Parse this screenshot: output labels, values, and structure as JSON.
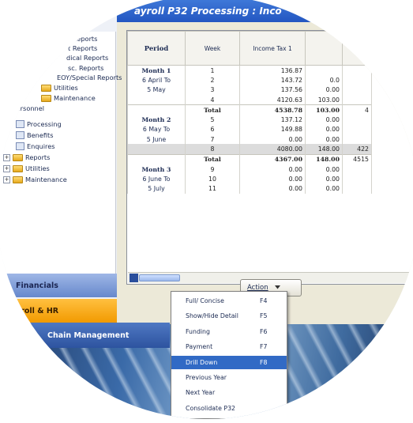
{
  "window": {
    "title": "ayroll P32 Processing : Inco"
  },
  "tree": {
    "items": [
      {
        "label": "Reports",
        "kind": "text"
      },
      {
        "label": "t Reports",
        "kind": "text"
      },
      {
        "label": "dical Reports",
        "kind": "text"
      },
      {
        "label": "sc. Reports",
        "kind": "text"
      },
      {
        "label": "EOY/Special Reports",
        "kind": "text"
      },
      {
        "label": "Utilities",
        "kind": "folder"
      },
      {
        "label": "Maintenance",
        "kind": "folder"
      },
      {
        "label": "Personnel",
        "kind": "folder"
      },
      {
        "label": "Processing",
        "kind": "doc"
      },
      {
        "label": "Benefits",
        "kind": "doc"
      },
      {
        "label": "Enquires",
        "kind": "doc"
      },
      {
        "label": "Reports",
        "kind": "folder"
      },
      {
        "label": "Utilities",
        "kind": "folder"
      },
      {
        "label": "Maintenance",
        "kind": "folder"
      }
    ]
  },
  "nav": {
    "financials": "Financials",
    "payroll": "yroll & HR",
    "chain": "Chain Management"
  },
  "grid": {
    "headers": [
      "Period",
      "Week",
      "Income Tax 1",
      "",
      ""
    ],
    "rows": [
      {
        "period": "Month 1",
        "pb": true,
        "week": "1",
        "tax": "136.87",
        "c4": "",
        "c5": ""
      },
      {
        "period": "6 April To",
        "week": "2",
        "tax": "143.72",
        "c4": "0.0",
        "c5": ""
      },
      {
        "period": "5 May",
        "week": "3",
        "tax": "137.56",
        "c4": "0.00",
        "c5": ""
      },
      {
        "period": "",
        "week": "4",
        "tax": "4120.63",
        "c4": "103.00",
        "c5": ""
      },
      {
        "period": "",
        "week": "Total",
        "wb": true,
        "tax": "4538.78",
        "c4": "103.00",
        "c5": "4",
        "bold": true,
        "tot": true
      },
      {
        "period": "Month 2",
        "pb": true,
        "week": "5",
        "tax": "137.12",
        "c4": "0.00",
        "c5": ""
      },
      {
        "period": "6 May To",
        "week": "6",
        "tax": "149.88",
        "c4": "0.00",
        "c5": ""
      },
      {
        "period": "5 June",
        "week": "7",
        "tax": "0.00",
        "c4": "0.00",
        "c5": ""
      },
      {
        "period": "",
        "week": "8",
        "tax": "4080.00",
        "c4": "148.00",
        "c5": "422",
        "hl": true
      },
      {
        "period": "",
        "week": "Total",
        "wb": true,
        "tax": "4367.00",
        "c4": "148.00",
        "c5": "4515",
        "bold": true,
        "tot": true
      },
      {
        "period": "Month 3",
        "pb": true,
        "week": "9",
        "tax": "0.00",
        "c4": "0.00",
        "c5": ""
      },
      {
        "period": "6 June To",
        "week": "10",
        "tax": "0.00",
        "c4": "0.00",
        "c5": ""
      },
      {
        "period": "5 July",
        "week": "11",
        "tax": "0.00",
        "c4": "0.00",
        "c5": ""
      }
    ]
  },
  "action": {
    "label": "Action",
    "arrow": "chevron-down"
  },
  "menu": {
    "items": [
      {
        "label": "Full/ Concise",
        "key": "F4"
      },
      {
        "label": "Show/Hide Detail",
        "key": "F5"
      },
      {
        "label": "Funding",
        "key": "F6"
      },
      {
        "label": "Payment",
        "key": "F7"
      },
      {
        "label": "Drill Down",
        "key": "F8",
        "selected": true
      },
      {
        "label": "Previous Year",
        "key": ""
      },
      {
        "label": "Next Year",
        "key": ""
      },
      {
        "label": "Consolidate P32",
        "key": ""
      }
    ]
  },
  "colors": {
    "title": "#2356c1",
    "selection": "#316ac5",
    "payroll_bar": "#f29a00",
    "financials_bar": "#7a98d6"
  }
}
